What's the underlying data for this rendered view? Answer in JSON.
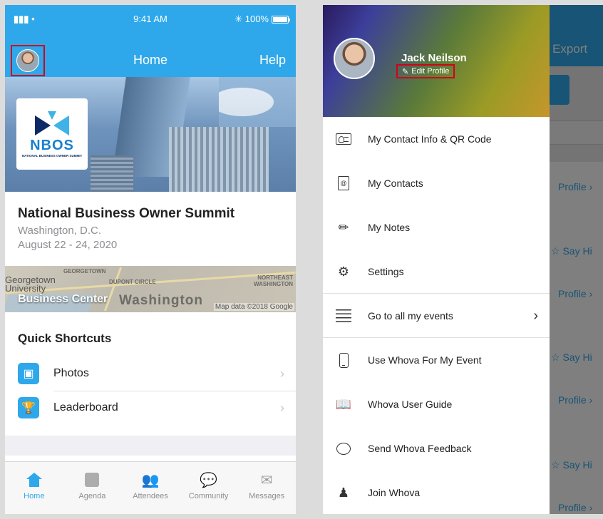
{
  "status_bar": {
    "signal": "▮▮▮ •",
    "time": "9:41 AM",
    "battery": "✳ 100%"
  },
  "left_screen": {
    "nav": {
      "title": "Home",
      "help_label": "Help"
    },
    "logo": {
      "text": "NBOS",
      "subtext": "NATIONAL BUSINESS OWNER SUMMIT"
    },
    "event": {
      "name": "National Business Owner Summit",
      "location": "Washington, D.C.",
      "dates": "August 22 - 24, 2020"
    },
    "map": {
      "title": "Business Center",
      "labels": {
        "georgetown": "GEORGETOWN",
        "dupont": "DUPONT CIRCLE",
        "northeast": "NORTHEAST\nWASHINGTON",
        "georgetown_univ": "Georgetown\nUniversity",
        "city": "Washington"
      },
      "credit": "Map data ©2018 Google"
    },
    "quick_shortcuts": {
      "title": "Quick Shortcuts",
      "items": [
        {
          "label": "Photos",
          "icon": "photo-icon"
        },
        {
          "label": "Leaderboard",
          "icon": "trophy-icon"
        }
      ]
    },
    "tabbar": {
      "active_color": "#2ea8ea",
      "tabs": [
        {
          "label": "Home",
          "icon": "home-icon",
          "active": true
        },
        {
          "label": "Agenda",
          "icon": "calendar-icon",
          "active": false
        },
        {
          "label": "Attendees",
          "icon": "people-icon",
          "active": false
        },
        {
          "label": "Community",
          "icon": "chat-bubbles-icon",
          "active": false
        },
        {
          "label": "Messages",
          "icon": "envelope-icon",
          "active": false
        }
      ]
    }
  },
  "right_screen": {
    "background": {
      "export_label": "Export",
      "profile_link": "Profile ›",
      "say_hi": "☆ Say Hi"
    },
    "drawer": {
      "user_name": "Jack Neilson",
      "edit_profile": "Edit Profile",
      "menu": [
        {
          "label": "My Contact Info & QR Code",
          "icon": "contact-card-icon"
        },
        {
          "label": "My Contacts",
          "icon": "address-book-icon"
        },
        {
          "label": "My Notes",
          "icon": "pencil-icon"
        },
        {
          "label": "Settings",
          "icon": "gear-icon"
        },
        {
          "label": "Go to all my events",
          "icon": "list-icon",
          "chevron": "›"
        },
        {
          "label": "Use Whova For My Event",
          "icon": "phone-icon"
        },
        {
          "label": "Whova User Guide",
          "icon": "guide-icon"
        },
        {
          "label": "Send Whova Feedback",
          "icon": "speech-bubble-icon"
        },
        {
          "label": "Join Whova",
          "icon": "user-join-icon"
        }
      ]
    }
  },
  "colors": {
    "brand_blue": "#2ea8ea",
    "highlight_red": "#d0021b"
  }
}
